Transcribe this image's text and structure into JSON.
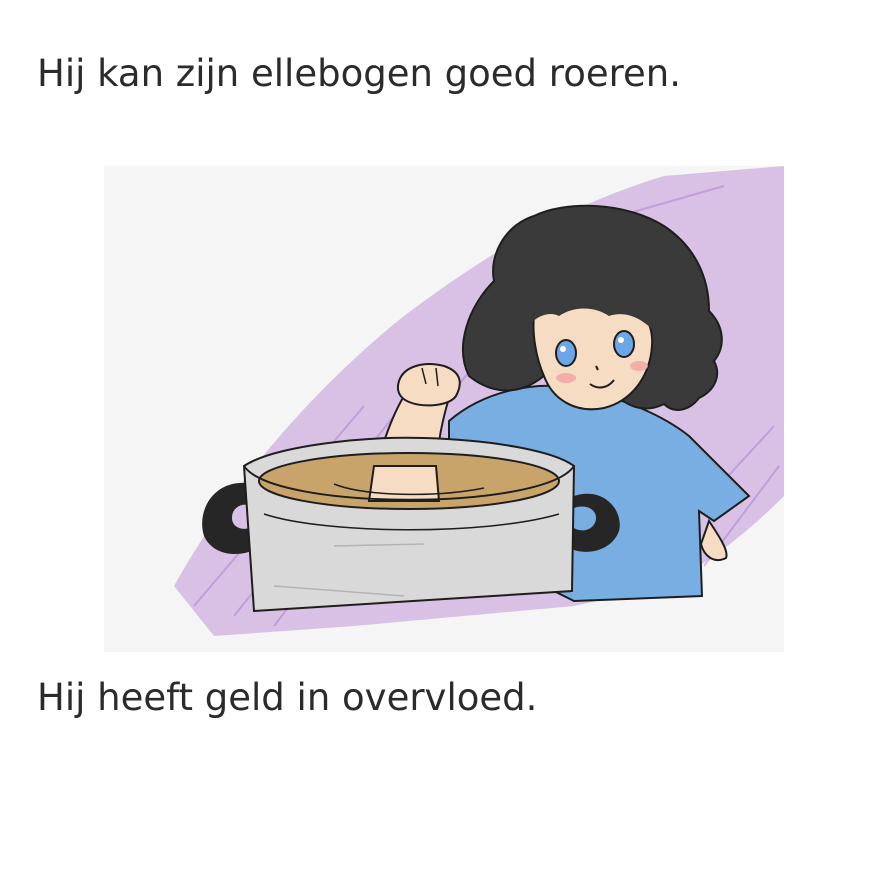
{
  "text": {
    "line_1": "Hij kan zijn ellebogen goed roeren.",
    "line_2": "Hij heeft geld in overvloed."
  },
  "illustration": {
    "subject": "child stirring a cooking pot with an arm",
    "colors": {
      "paper": "#f4f5f4",
      "purple_scribble": "#b07ad0",
      "hair": "#3a3a3a",
      "shirt": "#79aee3",
      "skin": "#f7dcc4",
      "soup": "#c9a46a",
      "pot": "#d9d9d9",
      "handles": "#262626",
      "eyes": "#6aa6e8",
      "blush": "#f1a3a3"
    }
  }
}
